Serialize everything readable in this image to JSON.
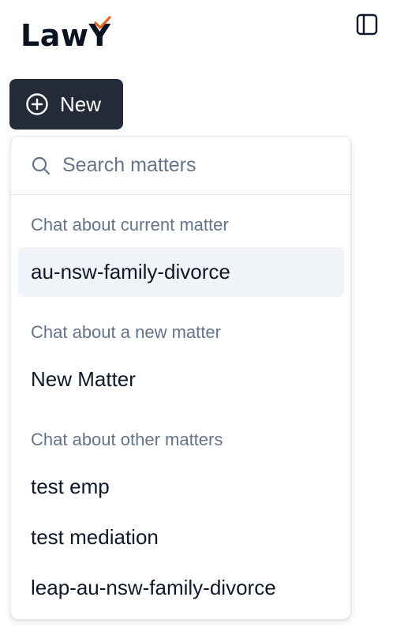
{
  "header": {
    "logo_text_main": "Law",
    "logo_text_accent": "Y",
    "brand_accent_color": "#e8651a",
    "toggle_icon": "sidebar-panel-icon"
  },
  "new_button": {
    "label": "New",
    "icon": "plus-circle-icon"
  },
  "dropdown": {
    "search": {
      "placeholder": "Search matters",
      "value": "",
      "icon": "search-icon"
    },
    "groups": [
      {
        "heading": "Chat about current matter",
        "items": [
          {
            "label": "au-nsw-family-divorce",
            "selected": true
          }
        ]
      },
      {
        "heading": "Chat about a new matter",
        "items": [
          {
            "label": "New Matter",
            "selected": false
          }
        ]
      },
      {
        "heading": "Chat about other matters",
        "items": [
          {
            "label": "test emp",
            "selected": false
          },
          {
            "label": "test mediation",
            "selected": false
          },
          {
            "label": "leap-au-nsw-family-divorce",
            "selected": false
          }
        ]
      }
    ]
  },
  "colors": {
    "button_bg": "#232a38",
    "muted_text": "#64748b",
    "selected_bg": "#f1f5f9"
  }
}
